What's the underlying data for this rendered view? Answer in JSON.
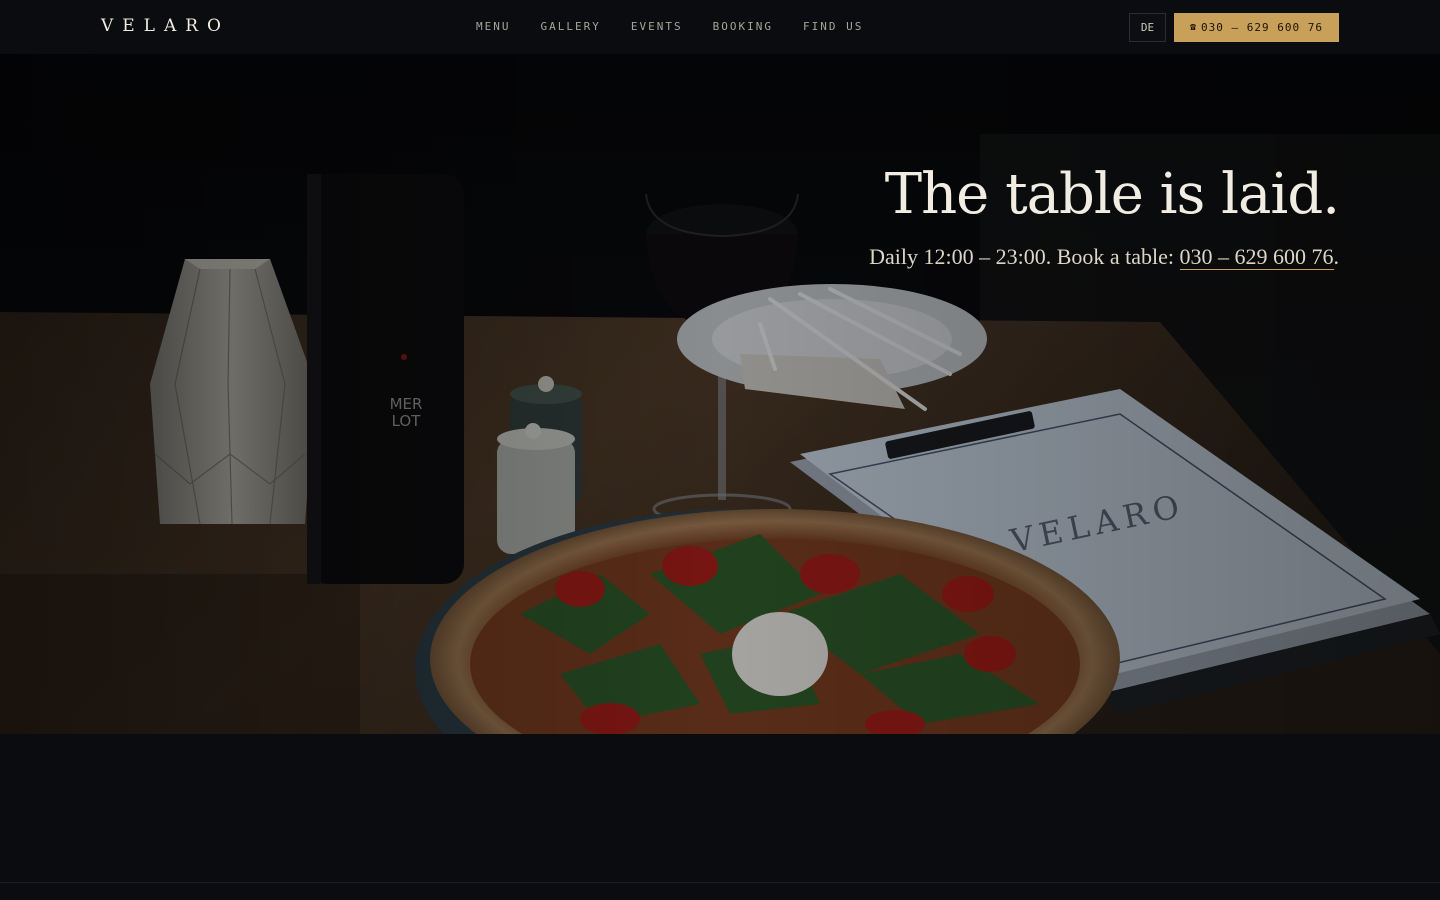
{
  "brand": {
    "logo": "VELARO"
  },
  "nav": {
    "items": [
      "MENU",
      "GALLERY",
      "EVENTS",
      "BOOKING",
      "FIND US"
    ]
  },
  "header": {
    "lang_label": "DE",
    "call_icon": "phone-icon",
    "call_label": "030 – 629 600 76"
  },
  "hero": {
    "title": "The table is laid.",
    "subtitle_prefix": "Daily 12:00 – 23:00. Book a table:",
    "phone": "030 – 629 600 76",
    "subtitle_suffix": ".",
    "bottle_label": "MER LOT",
    "menu_logo": "VELARO"
  },
  "colors": {
    "background": "#0a0c0f",
    "accent": "#c9a05a",
    "text": "#f2ede3"
  }
}
